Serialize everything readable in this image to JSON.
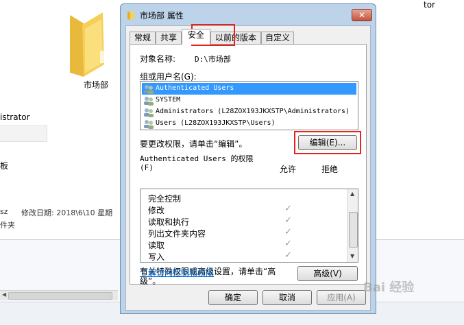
{
  "background": {
    "folder_name": "市场部",
    "sidebar_text": "istrator",
    "sidebar_text2": "板",
    "top_right_text": "tor",
    "status_left": "sz",
    "status_modified": "修改日期: 2018\\6\\10 星期",
    "status_type": "件夹"
  },
  "dialog": {
    "title": "市场部 属性",
    "close_glyph": "✕",
    "tabs": [
      "常规",
      "共享",
      "安全",
      "以前的版本",
      "自定义"
    ],
    "active_tab": "安全",
    "object_name_label": "对象名称:",
    "object_name_value": "D:\\市场部",
    "groups_label": "组或用户名(G):",
    "users": [
      "Authenticated Users",
      "SYSTEM",
      "Administrators (L28ZOX193JKXSTP\\Administrators)",
      "Users (L28ZOX193JKXSTP\\Users)"
    ],
    "selected_user": "Authenticated Users",
    "change_perm_text": "要更改权限，请单击“编辑”。",
    "edit_button": "编辑(E)...",
    "perm_for_label": "Authenticated Users 的权限",
    "perm_f_label": "(F)",
    "allow_header": "允许",
    "deny_header": "拒绝",
    "permissions": [
      {
        "name": "完全控制",
        "allow": false
      },
      {
        "name": "修改",
        "allow": true
      },
      {
        "name": "读取和执行",
        "allow": true
      },
      {
        "name": "列出文件夹内容",
        "allow": true
      },
      {
        "name": "读取",
        "allow": true
      },
      {
        "name": "写入",
        "allow": true
      }
    ],
    "check_glyph": "✓",
    "advanced_text_1": "有关特殊权限或高级设置，请单击“高",
    "advanced_text_2": "级”。",
    "advanced_button": "高级(V)",
    "learn_link": "了解访问控制和权限",
    "ok_button": "确定",
    "cancel_button": "取消",
    "apply_button": "应用(A)"
  },
  "watermark": "Bai 经验",
  "colors": {
    "highlight_box": "#e8231b",
    "selection": "#3399ff",
    "link": "#0066cc",
    "dialog_frame": "#bcd3ea"
  }
}
